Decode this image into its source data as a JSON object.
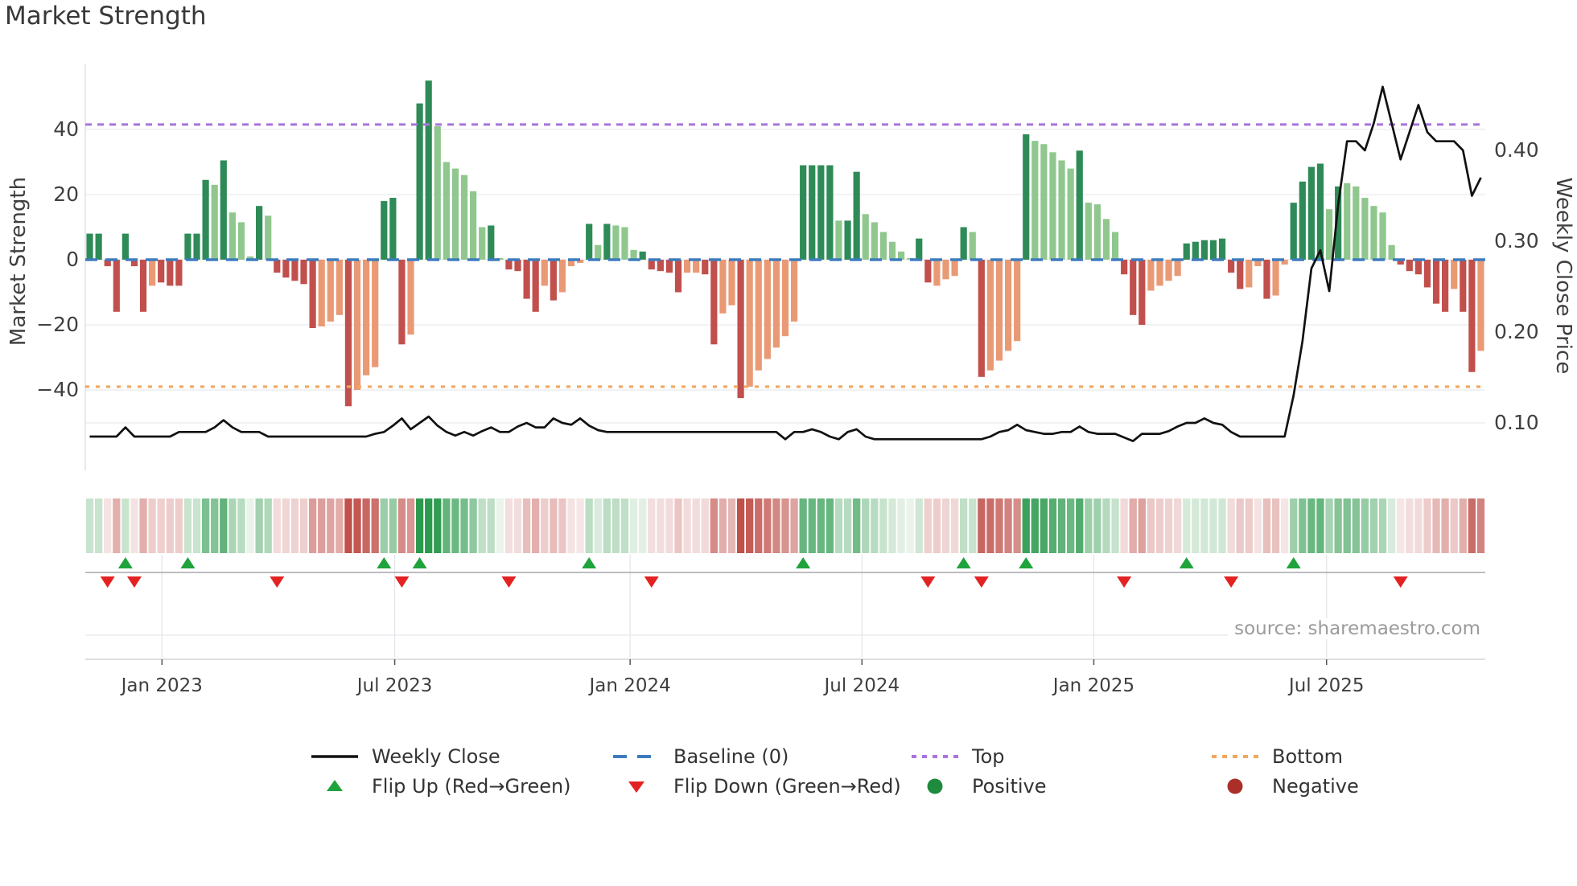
{
  "title": "Market Strength",
  "source": "source: sharemaestro.com",
  "axes": {
    "left_label": "Market Strength",
    "right_label": "Weekly Close Price",
    "left_ticks": [
      "40",
      "20",
      "0",
      "−20",
      "−40"
    ],
    "left_tick_values": [
      40,
      20,
      0,
      -20,
      -40
    ],
    "right_ticks": [
      "0.40",
      "0.30",
      "0.20",
      "0.10"
    ],
    "right_tick_values": [
      0.4,
      0.3,
      0.2,
      0.1
    ],
    "x_ticks": [
      "Jan 2023",
      "Jul 2023",
      "Jan 2024",
      "Jul 2024",
      "Jan 2025",
      "Jul 2025"
    ],
    "x_tick_weeks": [
      8.1,
      34.2,
      60.6,
      86.6,
      112.6,
      138.7
    ]
  },
  "ref_lines": {
    "baseline": {
      "label": "Baseline (0)",
      "value": 0
    },
    "top": {
      "label": "Top",
      "value": 41.5
    },
    "bottom": {
      "label": "Bottom",
      "value": -39
    }
  },
  "legend": {
    "rows": [
      [
        {
          "swatch": "line-black",
          "label": "Weekly Close"
        },
        {
          "swatch": "dash-blue",
          "label": "Baseline (0)"
        },
        {
          "swatch": "dot-purple",
          "label": "Top"
        },
        {
          "swatch": "dot-orange",
          "label": "Bottom"
        }
      ],
      [
        {
          "swatch": "triangle-up-green",
          "label": "Flip Up (Red→Green)"
        },
        {
          "swatch": "triangle-down-red",
          "label": "Flip Down (Green→Red)"
        },
        {
          "swatch": "circle-green",
          "label": "Positive"
        },
        {
          "swatch": "circle-darkred",
          "label": "Negative"
        }
      ]
    ]
  },
  "colors": {
    "bar_dark_green": "#2e8b57",
    "bar_light_green": "#90c78e",
    "bar_dark_red": "#c1504d",
    "bar_salmon": "#e99a75",
    "baseline_blue": "#3e7cbd",
    "top_purple": "#a873dd",
    "bottom_orange": "#f2a760",
    "close_line": "#111111",
    "flip_up_green": "#1fa33c",
    "flip_down_red": "#e32222",
    "positive_dot": "#1e8b3e",
    "negative_dot": "#ab2f28",
    "grid": "#e9e9f1",
    "heat_green_full": "#2c9a4e",
    "heat_green_pale": "#edf5ed",
    "heat_red_full": "#c0504a",
    "heat_red_pale": "#f7eaea"
  },
  "chart_data": {
    "type": "bar",
    "subtype": "weekly combo: strength bars + close price line + flip markers + strength heatmap",
    "n_weeks": 157,
    "xlabel": "",
    "ylabel_left": "Market Strength",
    "ylabel_right": "Weekly Close Price",
    "ylim_left": [
      -60,
      60
    ],
    "ylim_right_ticks": [
      0.1,
      0.4
    ],
    "series": [
      {
        "name": "Market Strength",
        "type": "bar",
        "values": [
          8,
          8,
          -2,
          -16,
          8,
          -2,
          -16,
          -8,
          -7,
          -8,
          -8,
          8,
          8,
          24.5,
          23,
          30.5,
          14.5,
          11.5,
          1,
          16.5,
          13.5,
          -4,
          -5.5,
          -6.5,
          -7.5,
          -21,
          -20.5,
          -19,
          -17,
          -45,
          -40,
          -35.5,
          -33,
          18,
          19,
          -26,
          -23,
          48,
          55,
          41,
          30,
          28,
          26,
          21,
          10,
          10.5,
          0.5,
          -3,
          -3.5,
          -12,
          -16,
          -8,
          -12.5,
          -10,
          -2,
          -1,
          11,
          4.5,
          11,
          10.5,
          10,
          3,
          2.5,
          -3,
          -3.5,
          -4,
          -10,
          -4,
          -4,
          -4.5,
          -26,
          -16.5,
          -14,
          -42.5,
          -39,
          -34,
          -30.5,
          -27,
          -23.5,
          -19,
          29,
          29,
          29,
          29,
          12,
          12,
          27,
          14,
          11.5,
          8.5,
          5.5,
          2.5,
          0.5,
          6.5,
          -7,
          -8,
          -6,
          -5,
          10,
          8.5,
          -36,
          -34,
          -31,
          -28,
          -25,
          38.5,
          36.5,
          35.5,
          33,
          30.5,
          28,
          33.5,
          17.5,
          17,
          12.5,
          8.5,
          -4.5,
          -17,
          -20,
          -9.5,
          -8,
          -6.5,
          -5,
          5,
          5.5,
          6,
          6,
          6.5,
          -4,
          -9,
          -8.5,
          -2,
          -12,
          -11,
          -1.5,
          17.5,
          24,
          28.5,
          29.5,
          15.5,
          22.5,
          23.5,
          22.5,
          19,
          16.5,
          14.5,
          4.5,
          -1.5,
          -3.5,
          -4.5,
          -8.5,
          -13.5,
          -16,
          -9,
          -16,
          -34.5,
          -28
        ],
        "bar_color_classes": [
          "dg",
          "dg",
          "dr",
          "dr",
          "dg",
          "dr",
          "dr",
          "sa",
          "dr",
          "dr",
          "dr",
          "dg",
          "dg",
          "dg",
          "lg",
          "dg",
          "lg",
          "lg",
          "lg",
          "dg",
          "lg",
          "dr",
          "dr",
          "dr",
          "dr",
          "dr",
          "sa",
          "sa",
          "sa",
          "dr",
          "sa",
          "sa",
          "sa",
          "dg",
          "dg",
          "dr",
          "sa",
          "dg",
          "dg",
          "lg",
          "lg",
          "lg",
          "lg",
          "lg",
          "lg",
          "dg",
          "lg",
          "dr",
          "dr",
          "dr",
          "dr",
          "sa",
          "dr",
          "sa",
          "sa",
          "sa",
          "dg",
          "lg",
          "dg",
          "lg",
          "lg",
          "lg",
          "dg",
          "dr",
          "dr",
          "dr",
          "dr",
          "sa",
          "sa",
          "dr",
          "dr",
          "sa",
          "sa",
          "dr",
          "sa",
          "sa",
          "sa",
          "sa",
          "sa",
          "sa",
          "dg",
          "dg",
          "dg",
          "dg",
          "lg",
          "dg",
          "dg",
          "lg",
          "lg",
          "lg",
          "lg",
          "lg",
          "lg",
          "dg",
          "dr",
          "sa",
          "sa",
          "sa",
          "dg",
          "lg",
          "dr",
          "sa",
          "sa",
          "sa",
          "sa",
          "dg",
          "lg",
          "lg",
          "lg",
          "lg",
          "lg",
          "dg",
          "lg",
          "lg",
          "lg",
          "lg",
          "dr",
          "dr",
          "dr",
          "sa",
          "sa",
          "sa",
          "sa",
          "dg",
          "dg",
          "dg",
          "dg",
          "dg",
          "dr",
          "dr",
          "sa",
          "sa",
          "dr",
          "sa",
          "sa",
          "dg",
          "dg",
          "dg",
          "dg",
          "lg",
          "dg",
          "lg",
          "lg",
          "lg",
          "lg",
          "lg",
          "lg",
          "dr",
          "dr",
          "dr",
          "dr",
          "dr",
          "dr",
          "sa",
          "dr",
          "dr",
          "sa"
        ]
      },
      {
        "name": "Weekly Close",
        "type": "line",
        "values": [
          0.085,
          0.085,
          0.085,
          0.085,
          0.095,
          0.085,
          0.085,
          0.085,
          0.085,
          0.085,
          0.09,
          0.09,
          0.09,
          0.09,
          0.095,
          0.103,
          0.095,
          0.09,
          0.09,
          0.09,
          0.085,
          0.085,
          0.085,
          0.085,
          0.085,
          0.085,
          0.085,
          0.085,
          0.085,
          0.085,
          0.085,
          0.085,
          0.088,
          0.09,
          0.097,
          0.105,
          0.093,
          0.1,
          0.107,
          0.097,
          0.09,
          0.086,
          0.09,
          0.086,
          0.091,
          0.095,
          0.09,
          0.09,
          0.096,
          0.1,
          0.095,
          0.095,
          0.105,
          0.1,
          0.098,
          0.105,
          0.097,
          0.092,
          0.09,
          0.09,
          0.09,
          0.09,
          0.09,
          0.09,
          0.09,
          0.09,
          0.09,
          0.09,
          0.09,
          0.09,
          0.09,
          0.09,
          0.09,
          0.09,
          0.09,
          0.09,
          0.09,
          0.09,
          0.082,
          0.09,
          0.09,
          0.093,
          0.09,
          0.085,
          0.082,
          0.09,
          0.093,
          0.085,
          0.082,
          0.082,
          0.082,
          0.082,
          0.082,
          0.082,
          0.082,
          0.082,
          0.082,
          0.082,
          0.082,
          0.082,
          0.082,
          0.085,
          0.09,
          0.092,
          0.098,
          0.092,
          0.09,
          0.088,
          0.088,
          0.09,
          0.09,
          0.096,
          0.09,
          0.088,
          0.088,
          0.088,
          0.084,
          0.08,
          0.088,
          0.088,
          0.088,
          0.091,
          0.096,
          0.1,
          0.1,
          0.105,
          0.1,
          0.098,
          0.09,
          0.085,
          0.085,
          0.085,
          0.085,
          0.085,
          0.085,
          0.13,
          0.19,
          0.27,
          0.29,
          0.245,
          0.34,
          0.41,
          0.41,
          0.4,
          0.43,
          0.47,
          0.43,
          0.39,
          0.42,
          0.45,
          0.42,
          0.41,
          0.41,
          0.41,
          0.4,
          0.35,
          0.37
        ]
      }
    ],
    "flip_up_weeks": [
      4,
      11,
      33,
      37,
      56,
      80,
      98,
      105,
      123,
      135
    ],
    "flip_down_weeks": [
      2,
      5,
      21,
      35,
      47,
      63,
      94,
      100,
      116,
      128,
      147
    ],
    "legend_position": "bottom",
    "grid": "horizontal"
  }
}
